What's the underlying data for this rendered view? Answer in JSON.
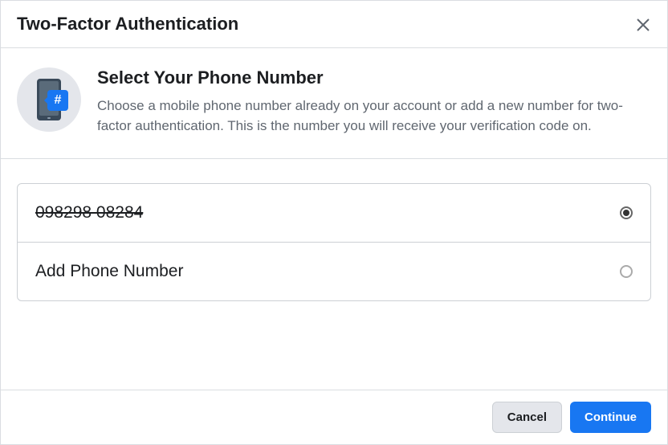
{
  "dialog": {
    "title": "Two-Factor Authentication",
    "heading": "Select Your Phone Number",
    "description": "Choose a mobile phone number already on your account or add a new number for two-factor authentication. This is the number you will receive your verification code on."
  },
  "options": {
    "existing_number": "098298 08284",
    "add_new_label": "Add Phone Number",
    "selected": "existing"
  },
  "icons": {
    "hash": "#"
  },
  "footer": {
    "cancel": "Cancel",
    "continue": "Continue"
  }
}
